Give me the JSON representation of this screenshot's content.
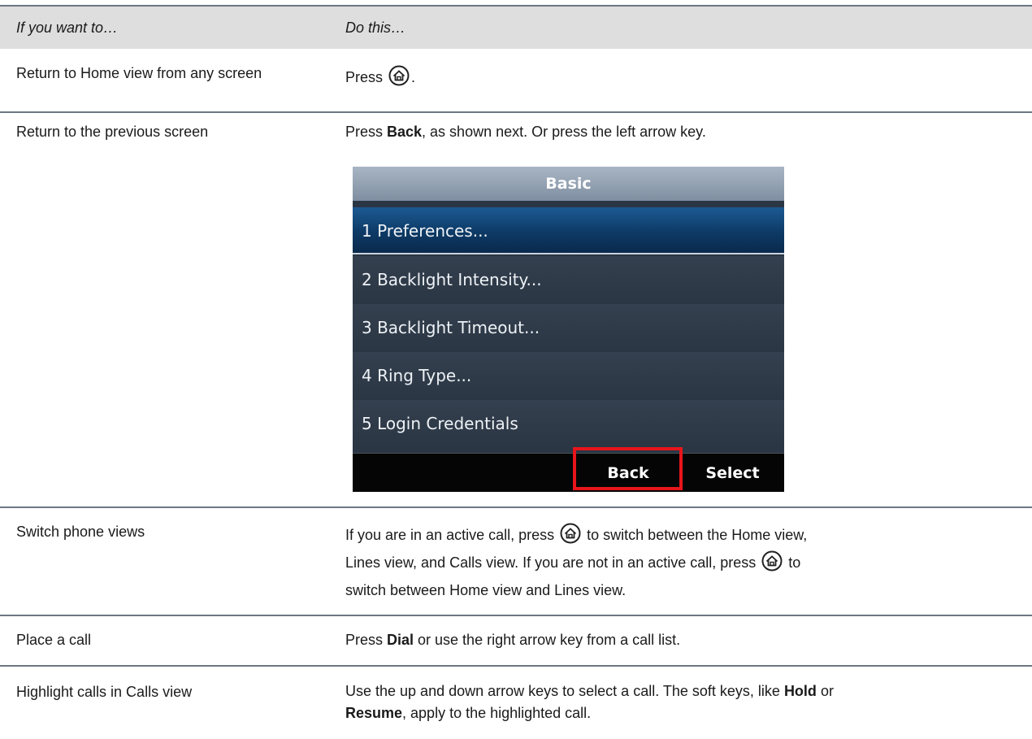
{
  "header": {
    "col1": "If you want to…",
    "col2": "Do this…"
  },
  "rows": [
    {
      "task": "Return to Home view from any screen",
      "press": "Press",
      "end": "."
    },
    {
      "task": "Return to the previous screen",
      "pre": "Press ",
      "bold": "Back",
      "post": ", as shown next. Or press the left arrow key."
    },
    {
      "task": "Switch phone views",
      "line1a": "If you are in an active call, press",
      "line1b": "to switch between the Home view,",
      "line2a": "Lines view, and Calls view. If you are not in an active call, press",
      "line2b": "to",
      "line3": "switch between Home view and Lines view."
    },
    {
      "task": "Place a call",
      "pre": "Press ",
      "bold": "Dial",
      "post": " or use the right arrow key from a call list."
    },
    {
      "task": "Highlight calls in Calls view",
      "pre": "Use the up and down arrow keys to select a call. The soft keys, like ",
      "bold1": "Hold",
      "mid": " or",
      "bold2": "Resume",
      "post": ", apply to the highlighted call."
    }
  ],
  "phone_screen": {
    "title": "Basic",
    "items": [
      "1 Preferences...",
      "2 Backlight Intensity...",
      "3 Backlight Timeout...",
      "4 Ring Type...",
      "5 Login Credentials"
    ],
    "softkeys": [
      "Back",
      "Select"
    ],
    "highlight_color": "#e8151b"
  },
  "icons": {
    "home": "home-icon"
  }
}
